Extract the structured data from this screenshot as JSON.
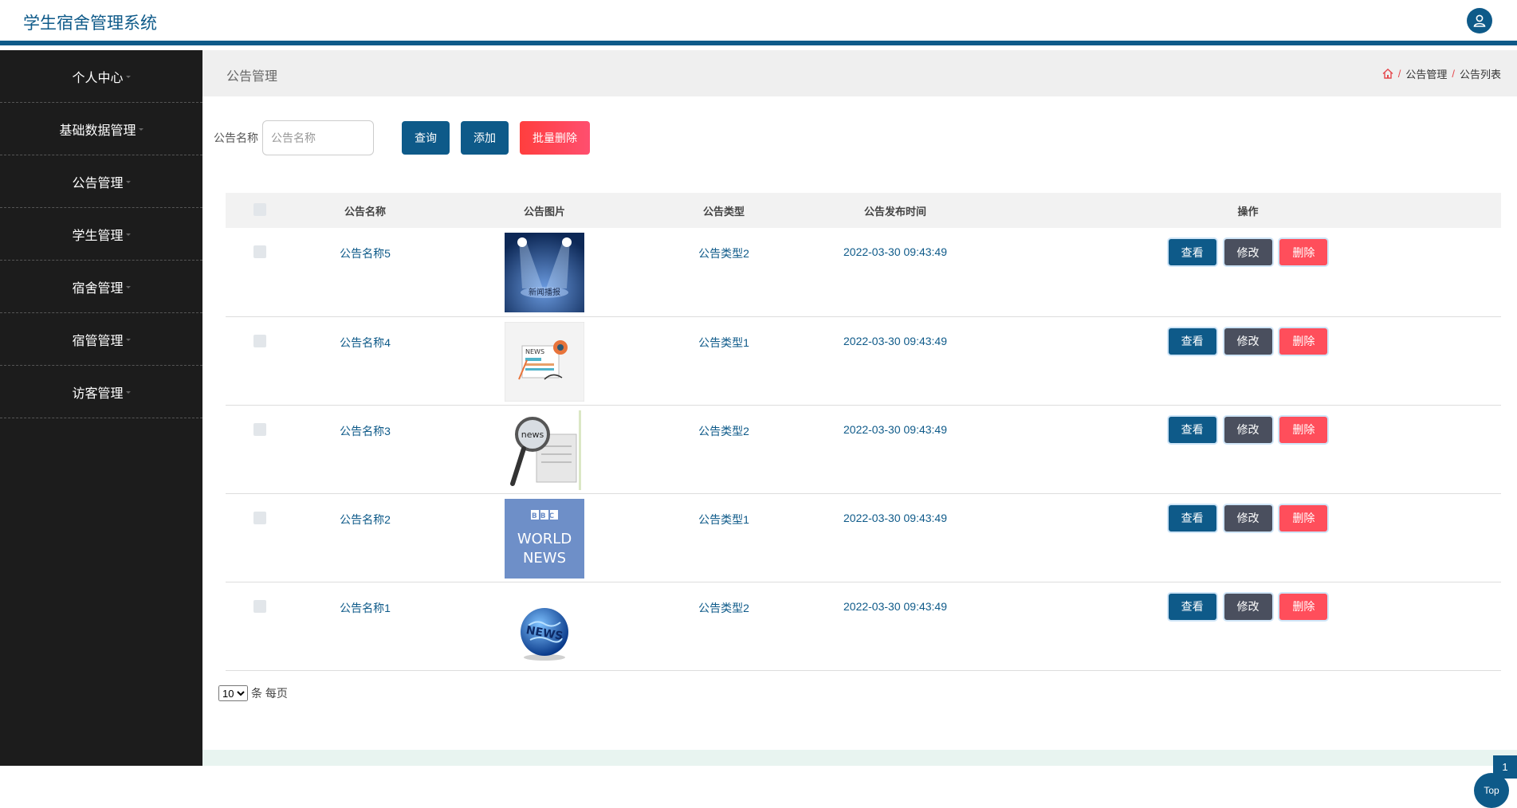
{
  "header": {
    "app_title": "学生宿舍管理系统"
  },
  "sidebar": {
    "items": [
      {
        "label": "个人中心"
      },
      {
        "label": "基础数据管理"
      },
      {
        "label": "公告管理"
      },
      {
        "label": "学生管理"
      },
      {
        "label": "宿舍管理"
      },
      {
        "label": "宿管管理"
      },
      {
        "label": "访客管理"
      }
    ]
  },
  "page": {
    "title": "公告管理",
    "breadcrumb": [
      "公告管理",
      "公告列表"
    ],
    "breadcrumb_sep": "/"
  },
  "search": {
    "label": "公告名称",
    "placeholder": "公告名称",
    "query_label": "查询",
    "add_label": "添加",
    "bulk_delete_label": "批量删除"
  },
  "table": {
    "columns": [
      "公告名称",
      "公告图片",
      "公告类型",
      "公告发布时间",
      "操作"
    ],
    "rows": [
      {
        "name": "公告名称5",
        "image": "stage-spotlight-news",
        "type": "公告类型2",
        "time": "2022-03-30 09:43:49"
      },
      {
        "name": "公告名称4",
        "image": "news-paper-illustration",
        "type": "公告类型1",
        "time": "2022-03-30 09:43:49"
      },
      {
        "name": "公告名称3",
        "image": "magnifier-newspaper",
        "type": "公告类型2",
        "time": "2022-03-30 09:43:49"
      },
      {
        "name": "公告名称2",
        "image": "bbc-world-news",
        "type": "公告类型1",
        "time": "2022-03-30 09:43:49"
      },
      {
        "name": "公告名称1",
        "image": "news-globe",
        "type": "公告类型2",
        "time": "2022-03-30 09:43:49"
      }
    ],
    "actions": {
      "view": "查看",
      "edit": "修改",
      "delete": "删除"
    }
  },
  "pager": {
    "page_size": "10",
    "options": [
      "10"
    ],
    "per_page_label": "条 每页",
    "current_page": "1"
  },
  "float": {
    "top_label": "Top"
  },
  "thumb_text": {
    "stage": "新闻播报",
    "bbc_line1": "BBC",
    "bbc_line2": "WORLD",
    "bbc_line3": "NEWS",
    "news": "NEWS",
    "news_lower": "news"
  },
  "colors": {
    "primary": "#0e5a89",
    "danger": "#ff4e5b",
    "edit": "#4a4f5e"
  }
}
